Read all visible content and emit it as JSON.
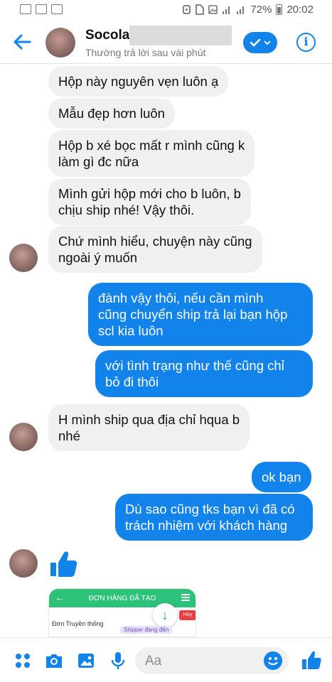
{
  "status_bar": {
    "battery": "72%",
    "time": "20:02",
    "app_icons": [
      "image-icon",
      "zalo-icon",
      "activity-icon"
    ]
  },
  "header": {
    "name": "Socola",
    "subtitle": "Thường trả lời sau vài phút"
  },
  "messages": [
    {
      "dir": "in",
      "text": "Hộp này nguyên vẹn luôn ạ"
    },
    {
      "dir": "in",
      "text": "Mẫu đẹp hơn luôn"
    },
    {
      "dir": "in",
      "text": "Hộp b xé bọc mất r mình cũng k\nlàm gì đc nữa"
    },
    {
      "dir": "in",
      "text": "Mình gửi hộp mới cho b luôn, b\nchịu ship nhé! Vậy thôi."
    },
    {
      "dir": "in",
      "text": "Chứ mình hiểu, chuyện này cũng\nngoài ý muốn"
    },
    {
      "dir": "out",
      "text": "đành vậy thôi, nếu cần mình\ncũng chuyển ship trả lại bạn hộp\nscl kia luôn"
    },
    {
      "dir": "out",
      "text": "với tình trạng như thế cũng chỉ\nbỏ đi thôi"
    },
    {
      "dir": "in",
      "text": "H mình ship qua địa chỉ hqua b\nnhé"
    },
    {
      "dir": "out",
      "text": "ok bạn"
    },
    {
      "dir": "out",
      "text": "Dù sao cũng tks bạn vì đã có\ntrách nhiệm với khách hàng"
    }
  ],
  "screenshot_preview": {
    "title": "ĐƠN HÀNG ĐÃ TẠO",
    "row_label": "Đơn Truyền thống",
    "badge": "Hủy",
    "status": "Shipper đang đến"
  },
  "composer": {
    "placeholder": "Aa"
  },
  "colors": {
    "accent": "#1283ea",
    "incoming_bubble": "#f1f0f0",
    "preview_bar": "#2cc27a"
  }
}
